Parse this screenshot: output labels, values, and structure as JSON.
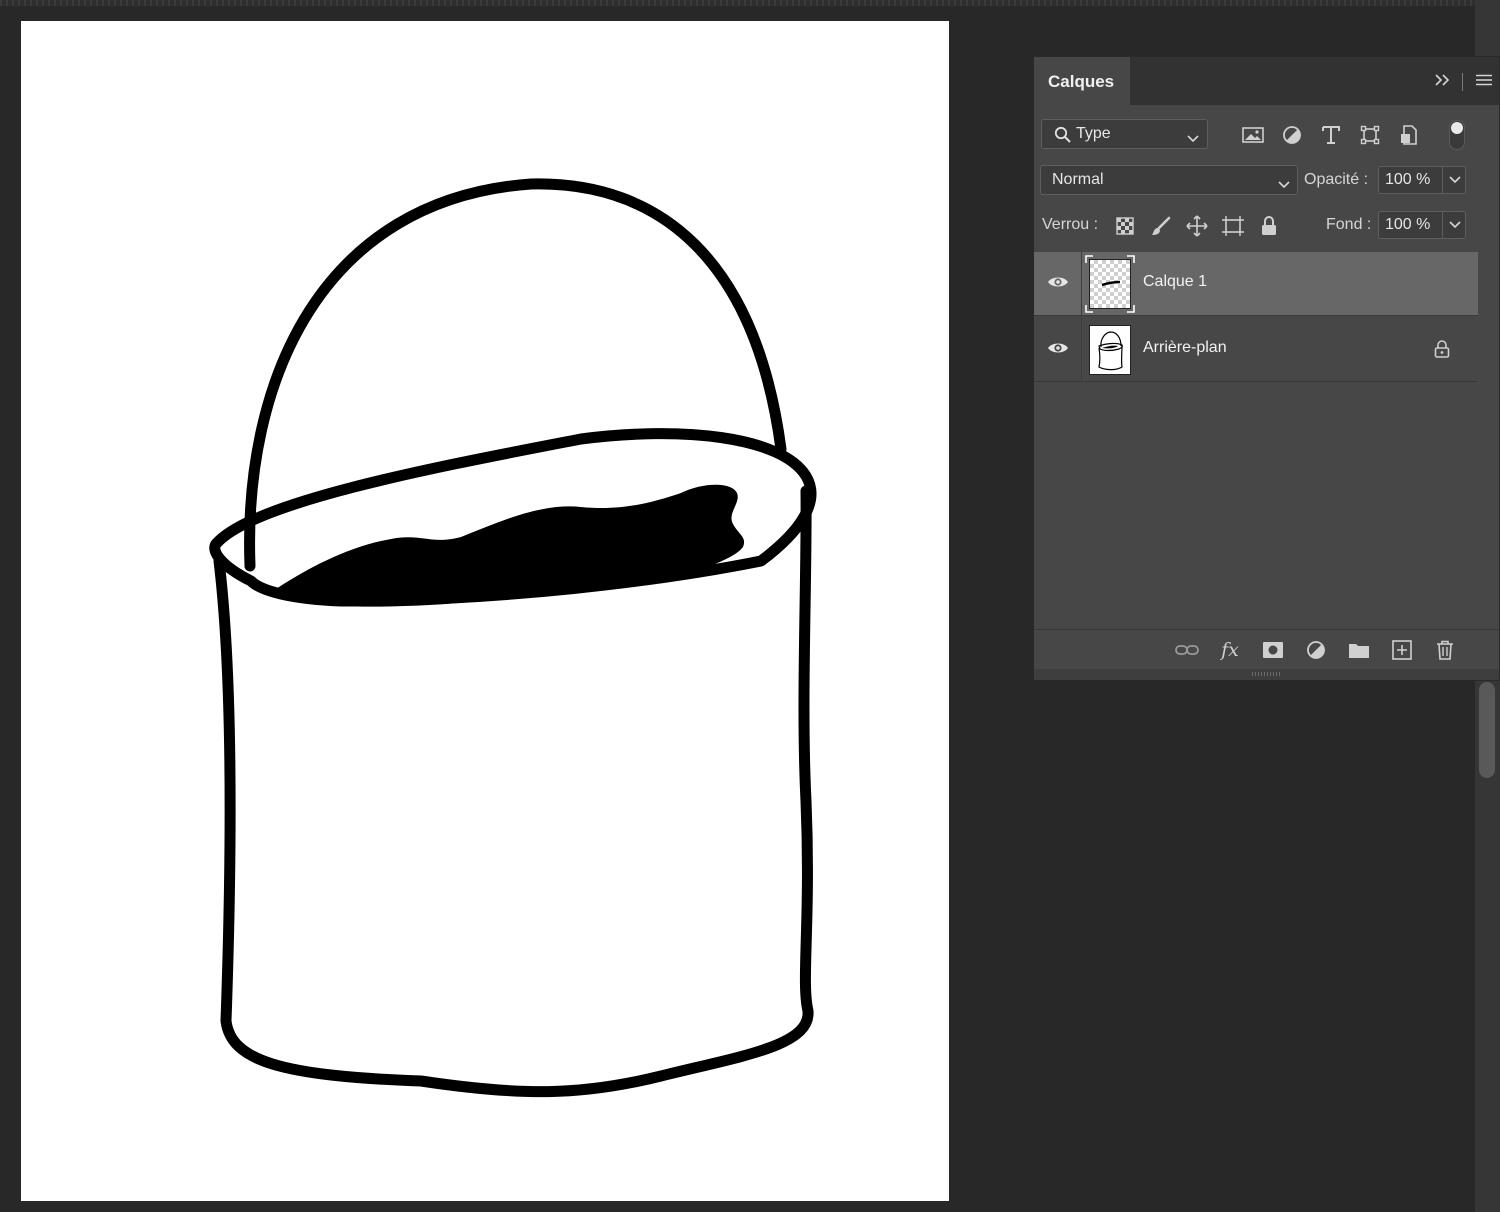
{
  "panel": {
    "tab_label": "Calques",
    "filter": {
      "label": "Type",
      "icon": "search-icon"
    },
    "blend_mode": "Normal",
    "opacity_label": "Opacité :",
    "opacity_value": "100 %",
    "lock_label": "Verrou :",
    "fill_label": "Fond :",
    "fill_value": "100 %",
    "layers": [
      {
        "name": "Calque 1",
        "visible": true,
        "selected": true,
        "locked": false
      },
      {
        "name": "Arrière-plan",
        "visible": true,
        "selected": false,
        "locked": true
      }
    ],
    "filter_icons": [
      "image-filter-icon",
      "adjustment-filter-icon",
      "text-filter-icon",
      "shape-filter-icon",
      "smart-object-filter-icon"
    ],
    "lock_icons": [
      "lock-transparent-pixels-icon",
      "lock-image-pixels-icon",
      "lock-position-icon",
      "lock-artboard-icon",
      "lock-all-icon"
    ],
    "footer_icons": [
      "link-layers-icon",
      "fx-icon",
      "add-mask-icon",
      "adjustment-layer-icon",
      "new-group-icon",
      "new-layer-icon",
      "trash-icon"
    ]
  },
  "canvas": {
    "background": "#ffffff",
    "ink": "#000000"
  },
  "colors": {
    "workspace": "#282828",
    "panel": "#474747",
    "selected_layer": "#676767"
  }
}
